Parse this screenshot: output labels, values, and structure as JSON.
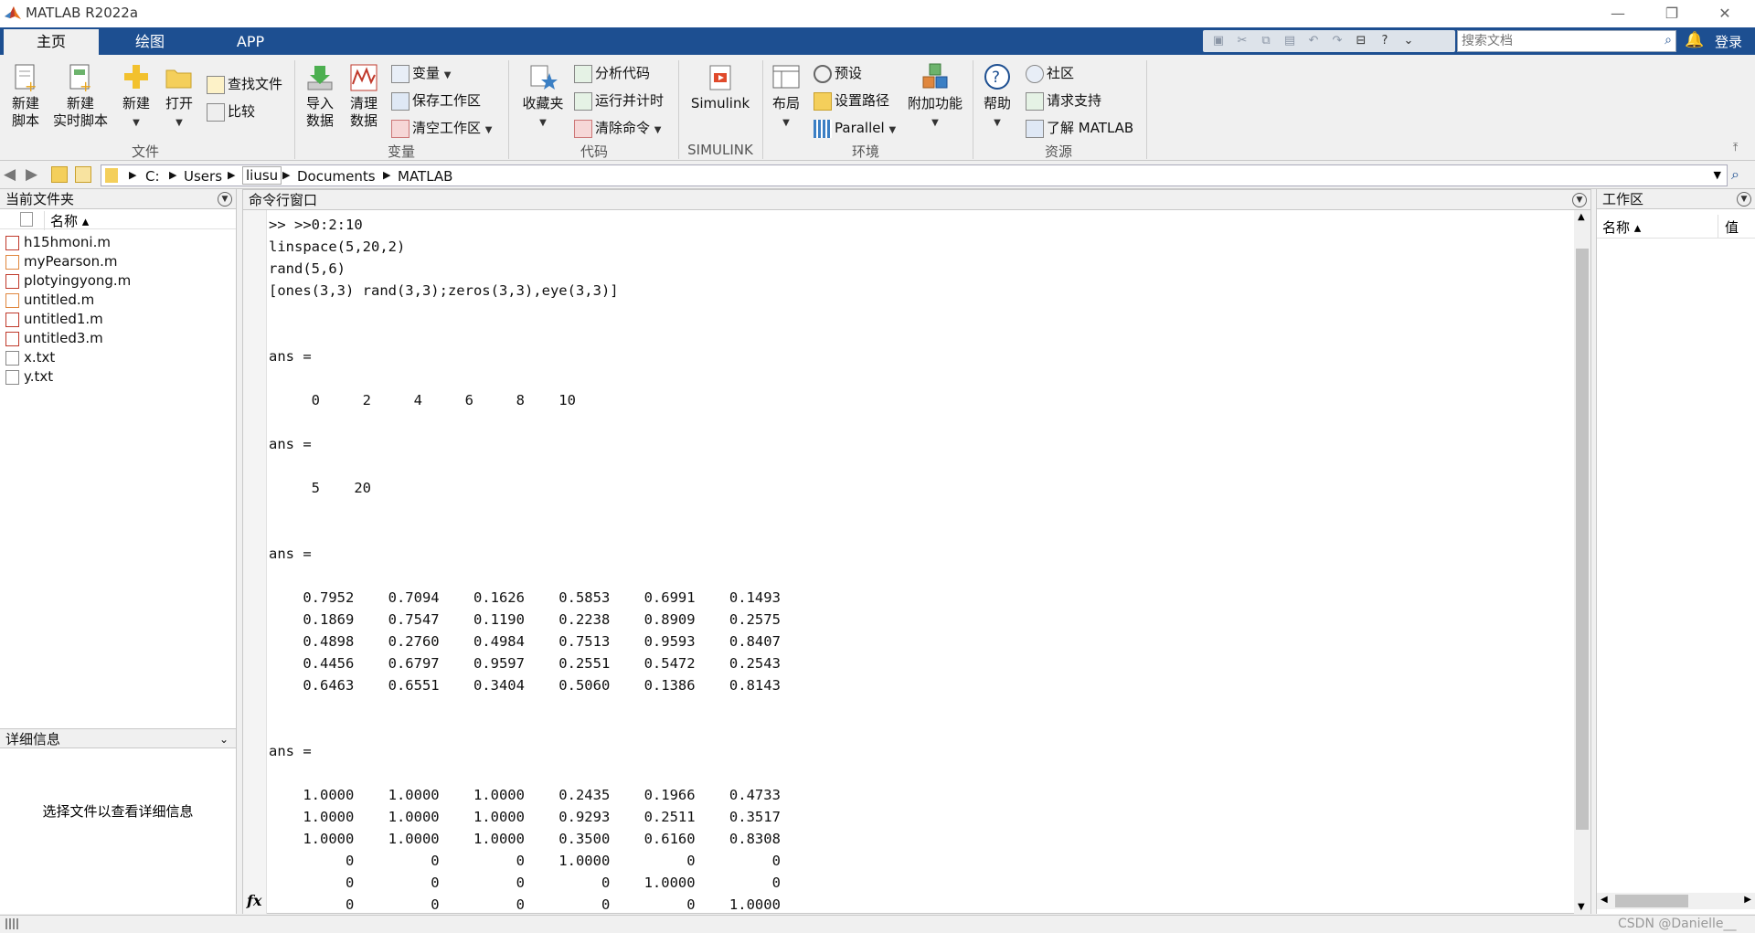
{
  "window": {
    "title": "MATLAB R2022a",
    "minimize": "—",
    "restore": "❐",
    "close": "✕"
  },
  "tabs": [
    {
      "label": "主页"
    },
    {
      "label": "绘图"
    },
    {
      "label": "APP"
    }
  ],
  "search": {
    "placeholder": "搜索文档"
  },
  "login": "登录",
  "ribbon": {
    "file": {
      "new_script": [
        "新建",
        "脚本"
      ],
      "new_live_script": [
        "新建",
        "实时脚本"
      ],
      "new": "新建",
      "open": "打开",
      "find_files": "查找文件",
      "compare": "比较",
      "group_label": "文件"
    },
    "variable": {
      "import_data": [
        "导入",
        "数据"
      ],
      "clean_data": [
        "清理",
        "数据"
      ],
      "variable": "变量",
      "save_workspace": "保存工作区",
      "clear_workspace": "清空工作区",
      "group_label": "变量"
    },
    "code": {
      "favorites": "收藏夹",
      "analyze_code": "分析代码",
      "run_and_time": "运行并计时",
      "clear_commands": "清除命令",
      "group_label": "代码"
    },
    "simulink": {
      "simulink": "Simulink",
      "group_label": "SIMULINK"
    },
    "environment": {
      "layout": "布局",
      "preferences": "预设",
      "set_path": "设置路径",
      "parallel": "Parallel",
      "addons": "附加功能",
      "group_label": "环境"
    },
    "resources": {
      "help": "帮助",
      "community": "社区",
      "request_support": "请求支持",
      "learn_matlab": "了解 MATLAB",
      "group_label": "资源"
    }
  },
  "path": [
    "C:",
    "Users",
    "liusu",
    "Documents",
    "MATLAB"
  ],
  "current_folder": {
    "title": "当前文件夹",
    "column_name": "名称 ▴",
    "files": [
      {
        "name": "h15hmoni.m",
        "type": "m-file"
      },
      {
        "name": "myPearson.m",
        "type": "m-fx"
      },
      {
        "name": "plotyingyong.m",
        "type": "m-file"
      },
      {
        "name": "untitled.m",
        "type": "m-fx"
      },
      {
        "name": "untitled1.m",
        "type": "m-file"
      },
      {
        "name": "untitled3.m",
        "type": "m-file"
      },
      {
        "name": "x.txt",
        "type": "txt"
      },
      {
        "name": "y.txt",
        "type": "txt"
      }
    ]
  },
  "details": {
    "title": "详细信息",
    "message": "选择文件以查看详细信息"
  },
  "command_window": {
    "title": "命令行窗口",
    "fx": "fx",
    "lines": [
      ">> >>0:2:10",
      "linspace(5,20,2)",
      "rand(5,6)",
      "[ones(3,3) rand(3,3);zeros(3,3),eye(3,3)]",
      "",
      "",
      "ans =",
      "",
      "     0     2     4     6     8    10",
      "",
      "ans =",
      "",
      "     5    20",
      "",
      "",
      "ans =",
      "",
      "    0.7952    0.7094    0.1626    0.5853    0.6991    0.1493",
      "    0.1869    0.7547    0.1190    0.2238    0.8909    0.2575",
      "    0.4898    0.2760    0.4984    0.7513    0.9593    0.8407",
      "    0.4456    0.6797    0.9597    0.2551    0.5472    0.2543",
      "    0.6463    0.6551    0.3404    0.5060    0.1386    0.8143",
      "",
      "",
      "ans =",
      "",
      "    1.0000    1.0000    1.0000    0.2435    0.1966    0.4733",
      "    1.0000    1.0000    1.0000    0.9293    0.2511    0.3517",
      "    1.0000    1.0000    1.0000    0.3500    0.6160    0.8308",
      "         0         0         0    1.0000         0         0",
      "         0         0         0         0    1.0000         0",
      "         0         0         0         0         0    1.0000"
    ]
  },
  "workspace": {
    "title": "工作区",
    "col_name": "名称 ▴",
    "col_value": "值"
  },
  "watermark": "CSDN @Danielle__",
  "colors": {
    "tab_bar": "#1d4f91",
    "ribbon_bg": "#f0f0f0",
    "accent_orange": "#e06a1b"
  }
}
